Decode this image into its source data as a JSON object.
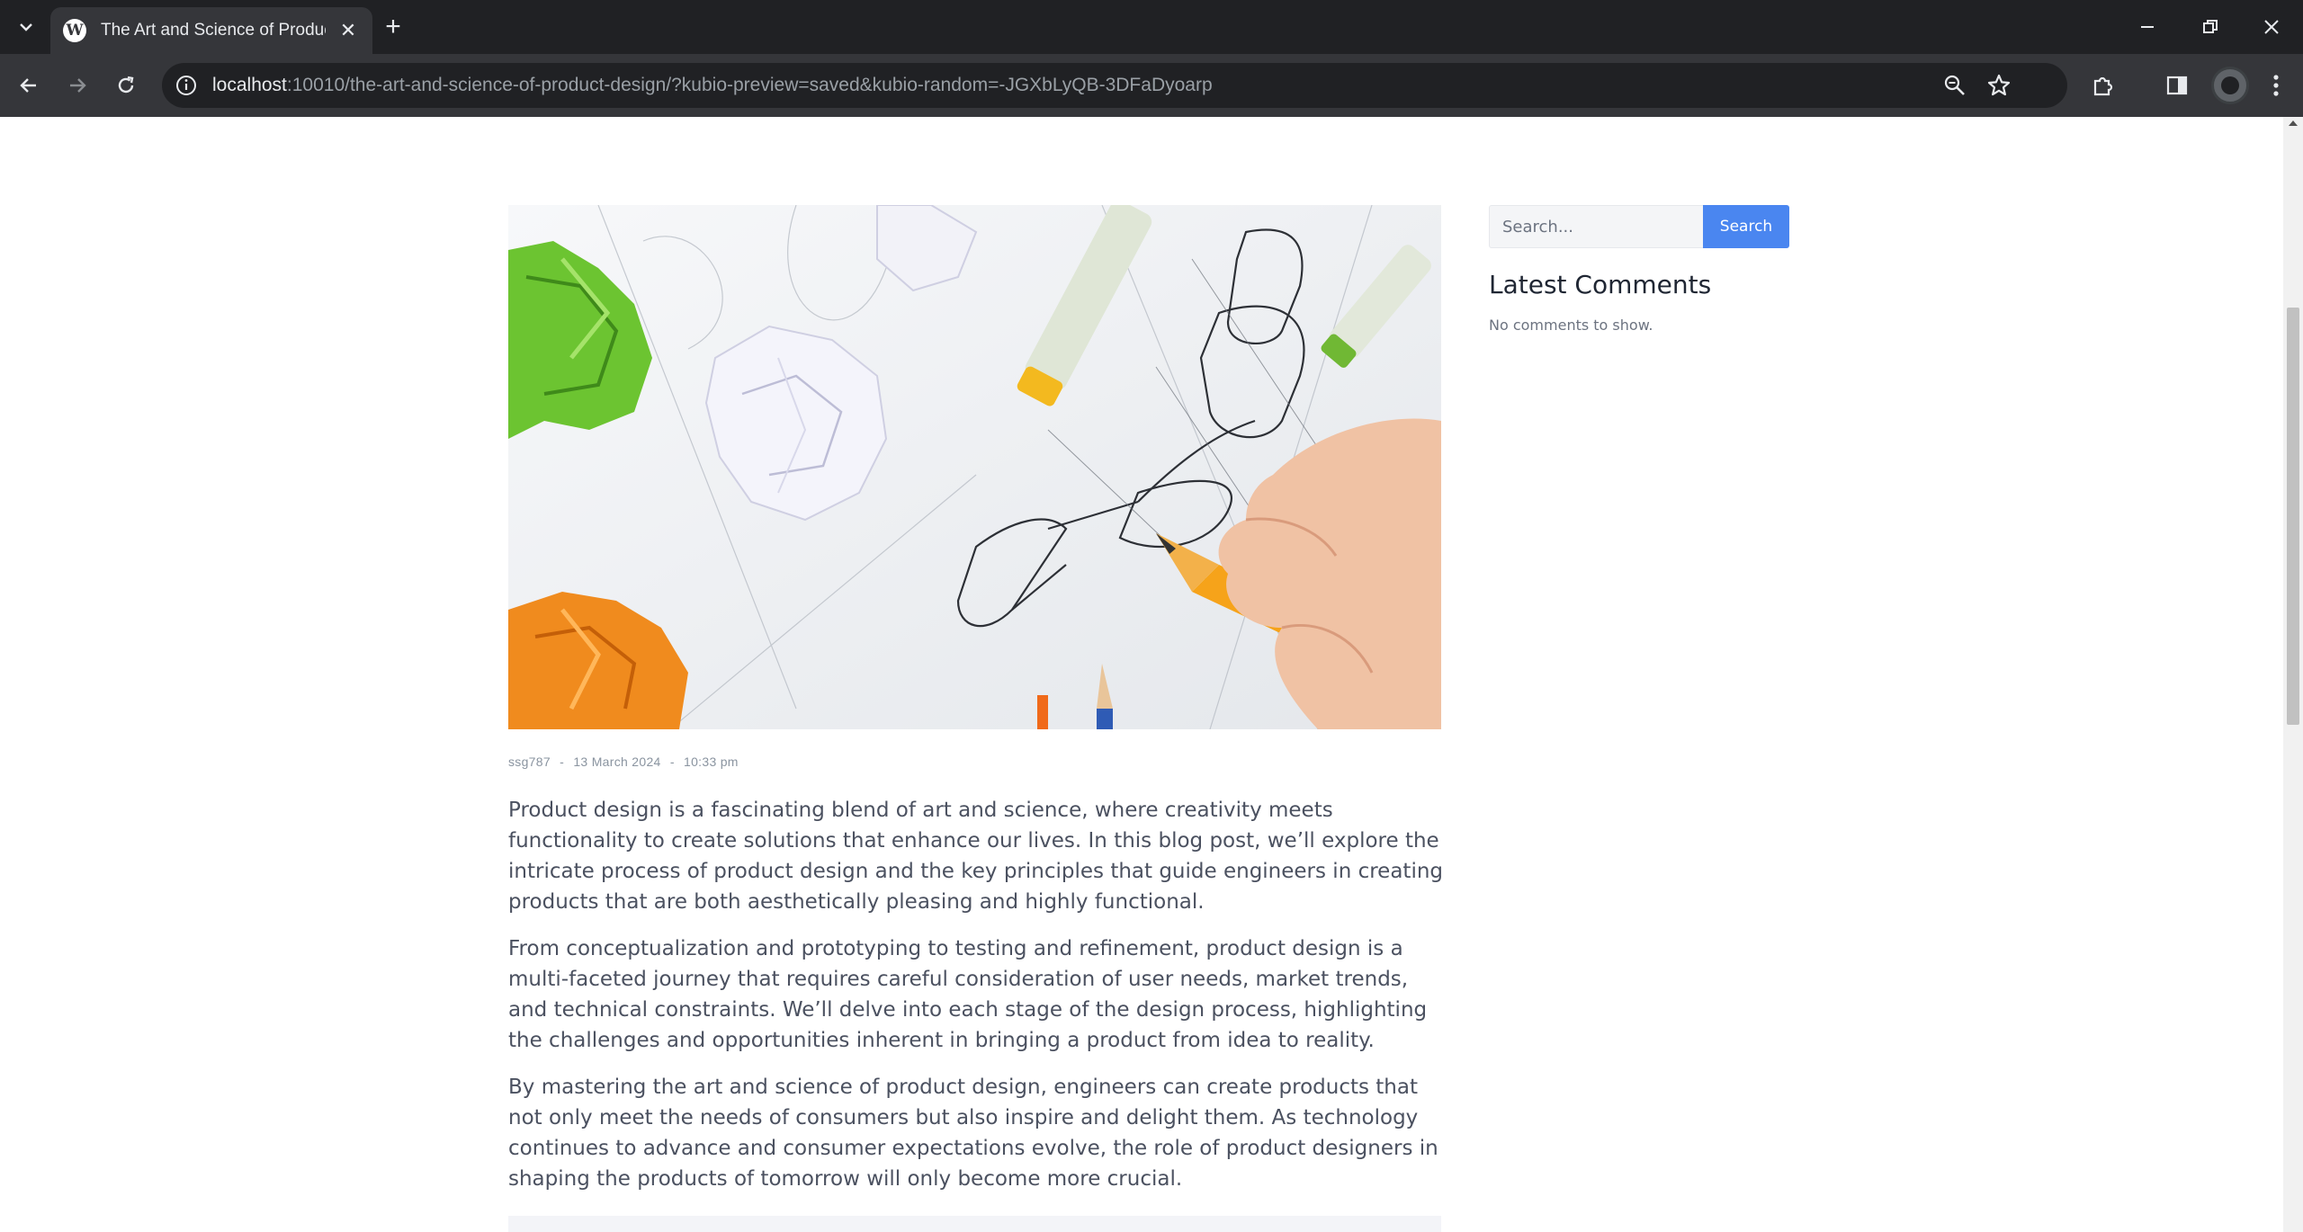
{
  "browser": {
    "tab": {
      "title": "The Art and Science of Product Design"
    },
    "address": {
      "host": "localhost",
      "path": ":10010/the-art-and-science-of-product-design/?kubio-preview=saved&kubio-random=-JGXbLyQB-3DFaDyoarp"
    }
  },
  "post": {
    "meta": {
      "author": "ssg787",
      "separator": "-",
      "date": "13 March 2024",
      "time": "10:33 pm"
    },
    "paragraphs": [
      "Product design is a fascinating blend of art and science, where creativity meets functionality to create solutions that enhance our lives. In this blog post, we’ll explore the intricate process of product design and the key principles that guide engineers in creating products that are both aesthetically pleasing and highly functional.",
      "From conceptualization and prototyping to testing and refinement, product design is a multi-faceted journey that requires careful consideration of user needs, market trends, and technical constraints. We’ll delve into each stage of the design process, highlighting the challenges and opportunities inherent in bringing a product from idea to reality.",
      "By mastering the art and science of product design, engineers can create products that not only meet the needs of consumers but also inspire and delight them. As technology continues to advance and consumer expectations evolve, the role of product designers in shaping the products of tomorrow will only become more crucial."
    ]
  },
  "sidebar": {
    "search": {
      "placeholder": "Search...",
      "button_label": "Search"
    },
    "latest_comments": {
      "title": "Latest Comments",
      "empty_text": "No comments to show."
    }
  },
  "colors": {
    "accent": "#4a86f0",
    "chrome_dark": "#202124",
    "chrome_mid": "#35363a"
  }
}
